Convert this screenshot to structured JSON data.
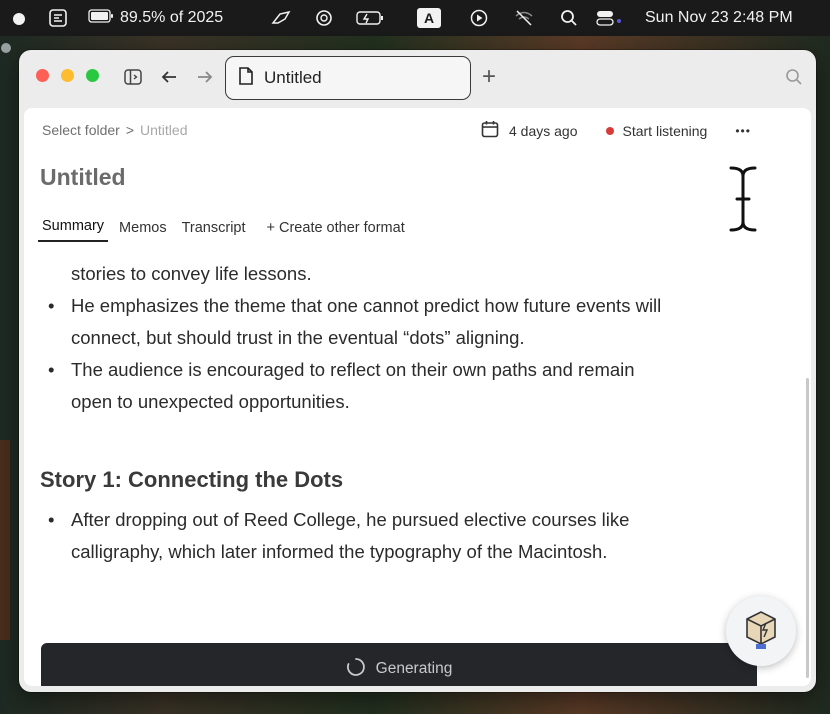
{
  "menubar": {
    "battery_text": "89.5% of 2025",
    "input_source": "A",
    "datetime": "Sun Nov 23  2:48 PM",
    "icons": [
      "app-switcher-icon",
      "battery-icon",
      "bird-icon",
      "openai-icon",
      "keyboard-battery-icon",
      "input-source-icon",
      "play-circle-icon",
      "wifi-off-icon",
      "search-icon",
      "control-center-icon"
    ]
  },
  "window": {
    "tab_title": "Untitled",
    "new_tab_label": "+",
    "breadcrumb": {
      "folder": "Select folder",
      "separator": ">",
      "current": "Untitled"
    },
    "meta": {
      "date": "4 days ago",
      "listen_label": "Start listening",
      "more_label": "•••"
    },
    "doc_title": "Untitled",
    "tabs": [
      "Summary",
      "Memos",
      "Transcript"
    ],
    "create_format_label": "+ Create other format",
    "body": {
      "continuation": "stories to convey life lessons.",
      "bullets_1": [
        {
          "line1": "He emphasizes the theme that one cannot predict how future events will",
          "line2": "connect, but should trust in the eventual “dots” aligning."
        },
        {
          "line1": "The audience is encouraged to reflect on their own paths and remain",
          "line2": "open to unexpected opportunities."
        }
      ],
      "section_heading": "Story 1: Connecting the Dots",
      "bullets_2": [
        {
          "line1": "After dropping out of Reed College, he pursued elective courses like",
          "line2": "calligraphy, which later informed the typography of the Macintosh."
        }
      ]
    },
    "generating_label": "Generating"
  },
  "colors": {
    "record_dot": "#d93a3a",
    "generate_bar": "#24262a",
    "traffic_red": "#fe5f57",
    "traffic_yellow": "#febc2e",
    "traffic_green": "#28c840"
  }
}
